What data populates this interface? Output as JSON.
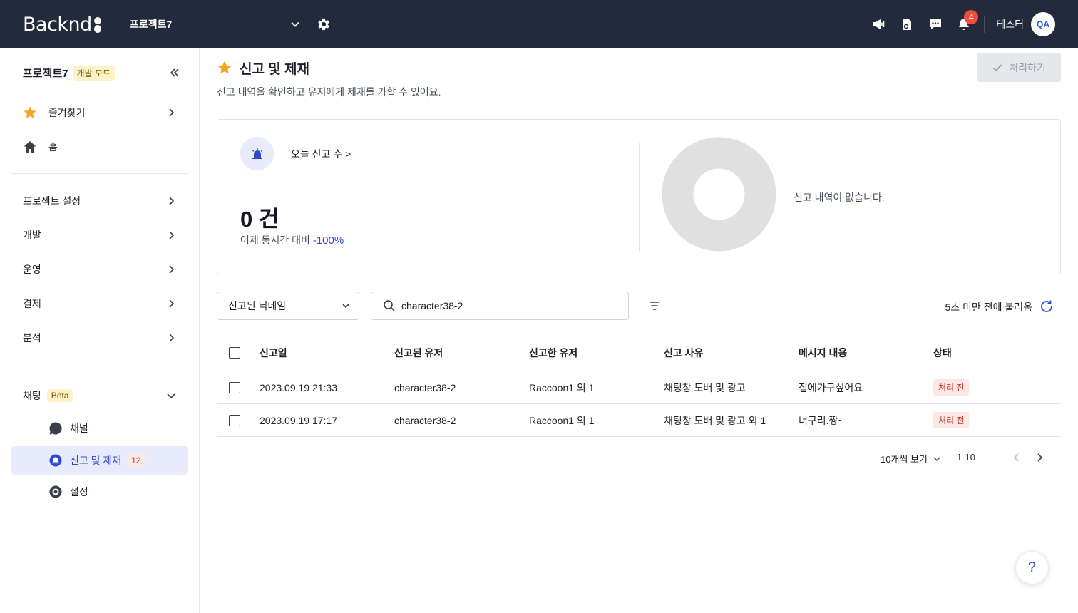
{
  "header": {
    "logo": "Backnd",
    "project": "프로젝트7",
    "notification_count": "4",
    "user_name": "테스터",
    "user_initials": "QA"
  },
  "sidebar": {
    "project_name": "프로젝트7",
    "mode_badge": "개발 모드",
    "items": [
      {
        "label": "즐겨찾기"
      },
      {
        "label": "홈"
      },
      {
        "label": "프로젝트 설정"
      },
      {
        "label": "개발"
      },
      {
        "label": "운영"
      },
      {
        "label": "결제"
      },
      {
        "label": "분석"
      },
      {
        "label": "채팅",
        "badge": "Beta"
      }
    ],
    "chat_sub": [
      {
        "label": "채널"
      },
      {
        "label": "신고 및 제재",
        "count": "12"
      },
      {
        "label": "설정"
      }
    ]
  },
  "main": {
    "title": "신고 및 제재",
    "description": "신고 내역을 확인하고 유저에게 제재를 가할 수 있어요.",
    "process_button": "처리하기",
    "stats": {
      "today_link": "오늘 신고 수 >",
      "count": "0 건",
      "compare_label": "어제 동시간 대비",
      "compare_value": "-100%",
      "empty_message": "신고 내역이 없습니다."
    },
    "filter": {
      "dropdown_value": "신고된 닉네임",
      "search_value": "character38-2",
      "refresh_text": "5초 미만 전에 불러옴"
    },
    "table": {
      "headers": [
        "신고일",
        "신고된 유저",
        "신고한 유저",
        "신고 사유",
        "메시지 내용",
        "상태"
      ],
      "rows": [
        [
          "2023.09.19 21:33",
          "character38-2",
          "Raccoon1 외 1",
          "채팅창 도배 및 광고",
          "집에가구싶어요",
          "처리 전"
        ],
        [
          "2023.09.19 17:17",
          "character38-2",
          "Raccoon1 외 1",
          "채팅창 도배 및 광고 외 1",
          "너구리.짱~",
          "처리 전"
        ]
      ]
    },
    "pagination": {
      "page_size": "10개씩 보기",
      "range": "1-10"
    },
    "help": "?"
  },
  "colors": {
    "topbar": "#232a3c",
    "accent": "#2f49d1",
    "star": "#f5a623",
    "status_bg": "#fde8e6",
    "status_text": "#c4321f"
  }
}
